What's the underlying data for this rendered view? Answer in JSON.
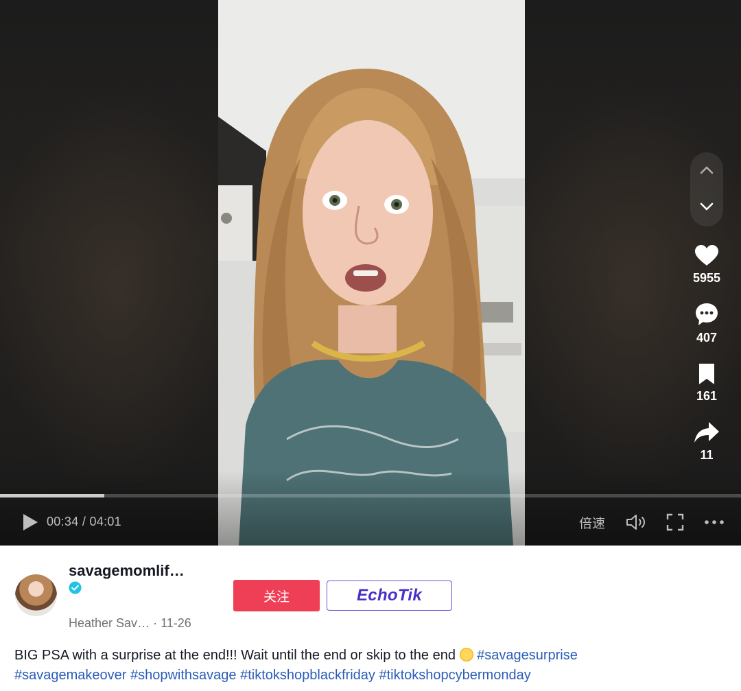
{
  "player": {
    "time_display": "00:34 / 04:01",
    "progress_fraction": 0.1411,
    "speed_label": "倍速",
    "controls": [
      "play-icon",
      "volume-icon",
      "fullscreen-icon",
      "more-icon"
    ]
  },
  "side_actions": {
    "nav": [
      "chevron-up-icon",
      "chevron-down-icon"
    ],
    "likes": "5955",
    "comments": "407",
    "saves": "161",
    "shares": "11"
  },
  "author": {
    "username": "savagemomlif…",
    "verified": true,
    "nickname": "Heather Sav…",
    "date": "· 11-26"
  },
  "buttons": {
    "follow_label": "关注",
    "echotik_label": "EchoTik"
  },
  "description": {
    "text": "BIG PSA with a surprise at the end!!! Wait until the end or skip to the end",
    "hashtags": [
      "#savagesurprise",
      "#savagemakeover",
      "#shopwithsavage",
      "#tiktokshopblackfriday",
      "#tiktokshopcybermonday"
    ]
  },
  "colors": {
    "accent_red": "#ef3f57",
    "hashtag_blue": "#2b5db9",
    "echotik_purple": "#4b2fc8"
  }
}
